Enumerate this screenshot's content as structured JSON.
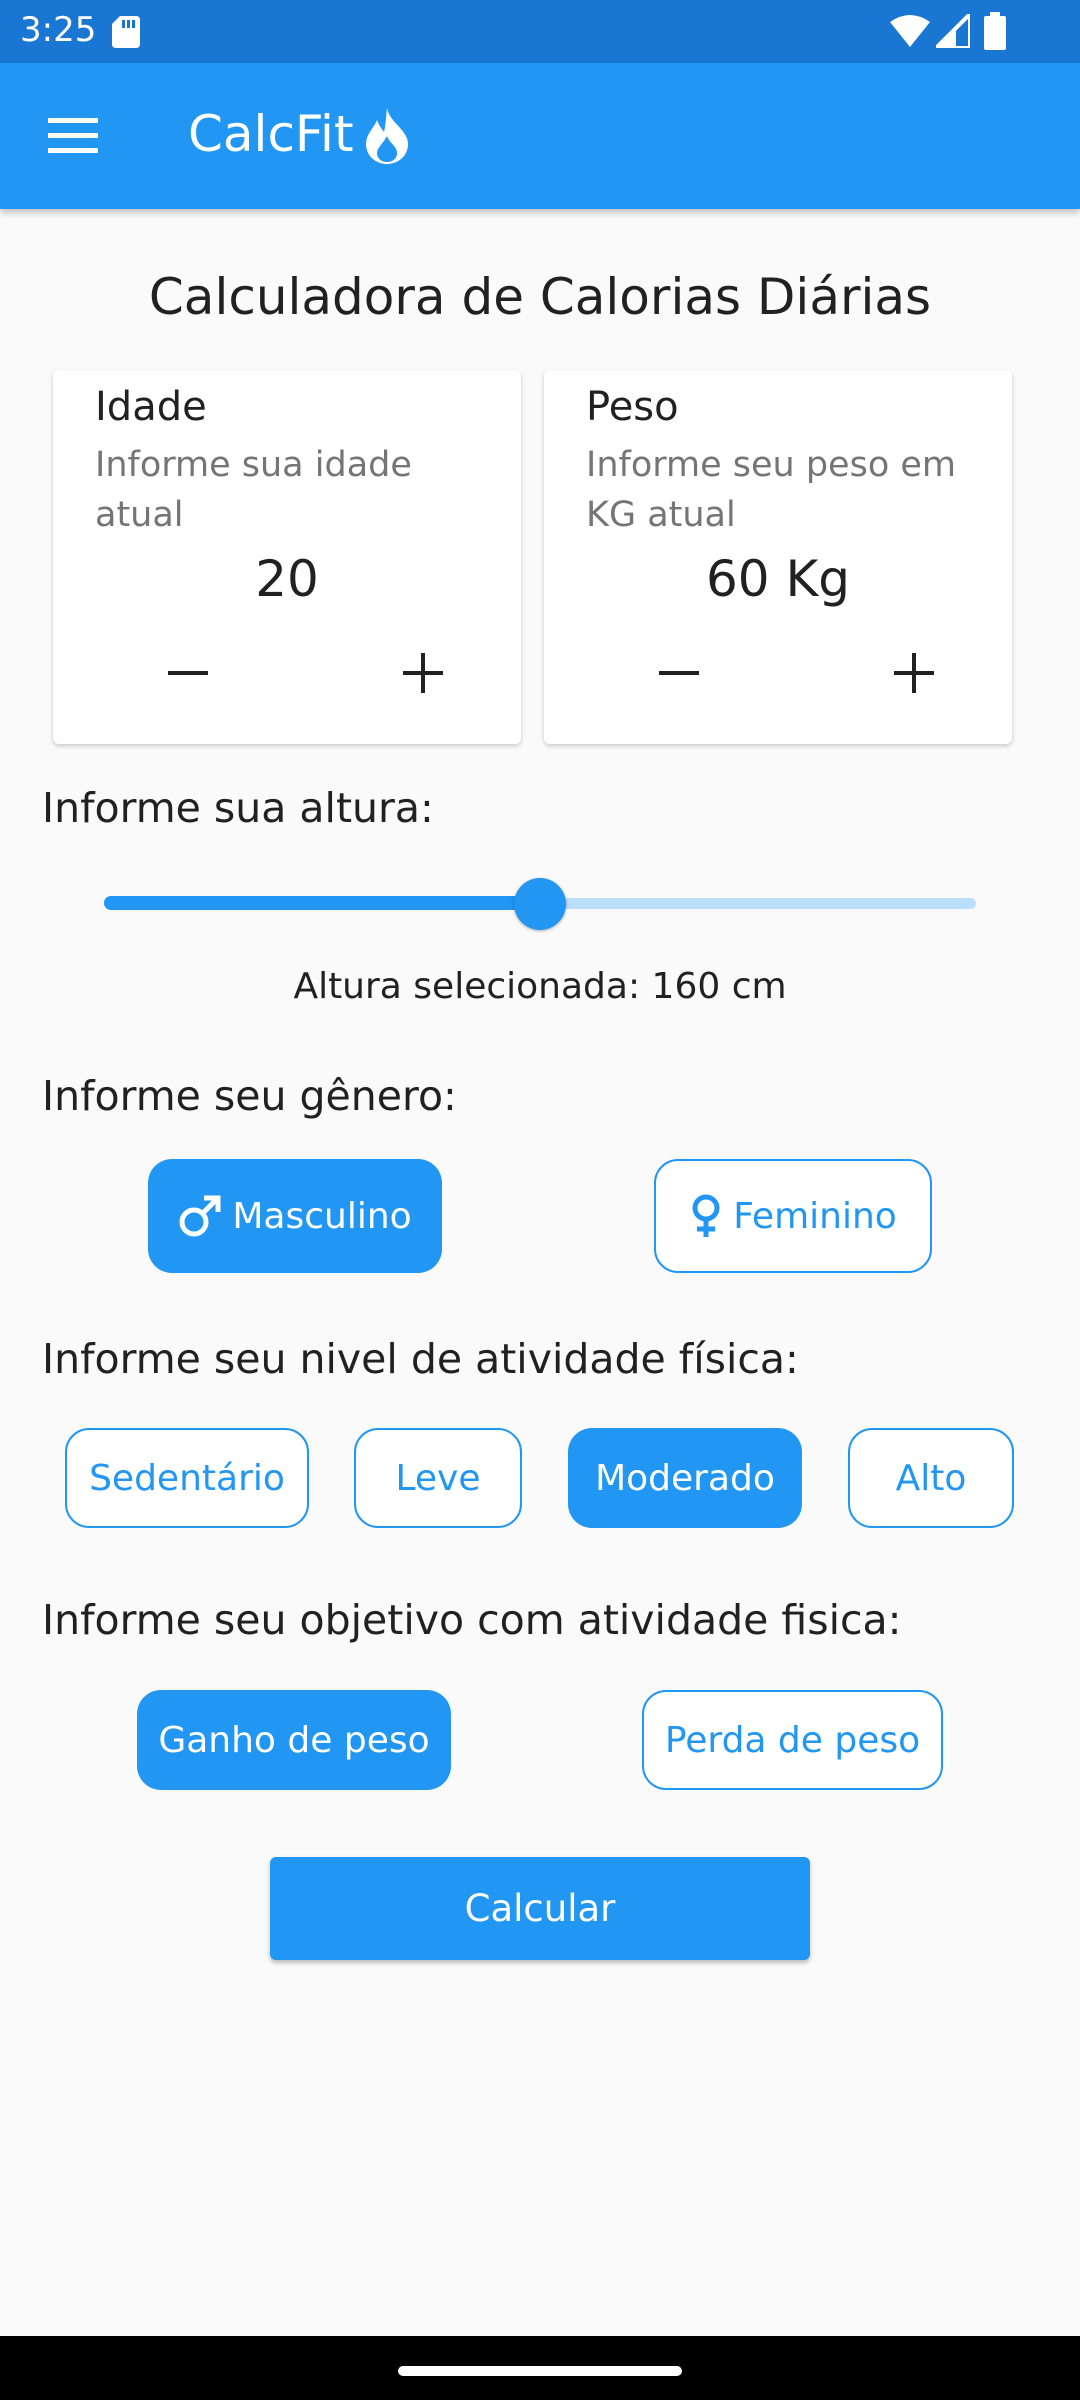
{
  "status_bar": {
    "time": "3:25"
  },
  "app_bar": {
    "title": "CalcFit"
  },
  "page": {
    "title": "Calculadora de Calorias Diárias"
  },
  "idade": {
    "label": "Idade",
    "hint": "Informe sua idade atual",
    "value": "20"
  },
  "peso": {
    "label": "Peso",
    "hint": "Informe seu peso em KG atual",
    "value": "60 Kg"
  },
  "altura": {
    "label": "Informe sua altura:",
    "readout": "Altura selecionada: 160 cm",
    "slider_fraction": 0.5
  },
  "genero": {
    "label": "Informe seu gênero:",
    "options": [
      "Masculino",
      "Feminino"
    ],
    "selected": "Masculino"
  },
  "atividade": {
    "label": "Informe seu nivel de atividade física:",
    "options": [
      "Sedentário",
      "Leve",
      "Moderado",
      "Alto"
    ],
    "selected": "Moderado"
  },
  "objetivo": {
    "label": "Informe seu objetivo com atividade fisica:",
    "options": [
      "Ganho de peso",
      "Perda de peso"
    ],
    "selected": "Ganho de peso"
  },
  "actions": {
    "calcular": "Calcular"
  },
  "colors": {
    "primary": "#2196f3",
    "status_bar": "#1976d2",
    "background": "#fafafa"
  },
  "icons": [
    "sd-card-icon",
    "wifi-icon",
    "signal-icon",
    "battery-icon",
    "menu-icon",
    "flame-icon",
    "minus-icon",
    "plus-icon",
    "male-icon",
    "female-icon"
  ]
}
